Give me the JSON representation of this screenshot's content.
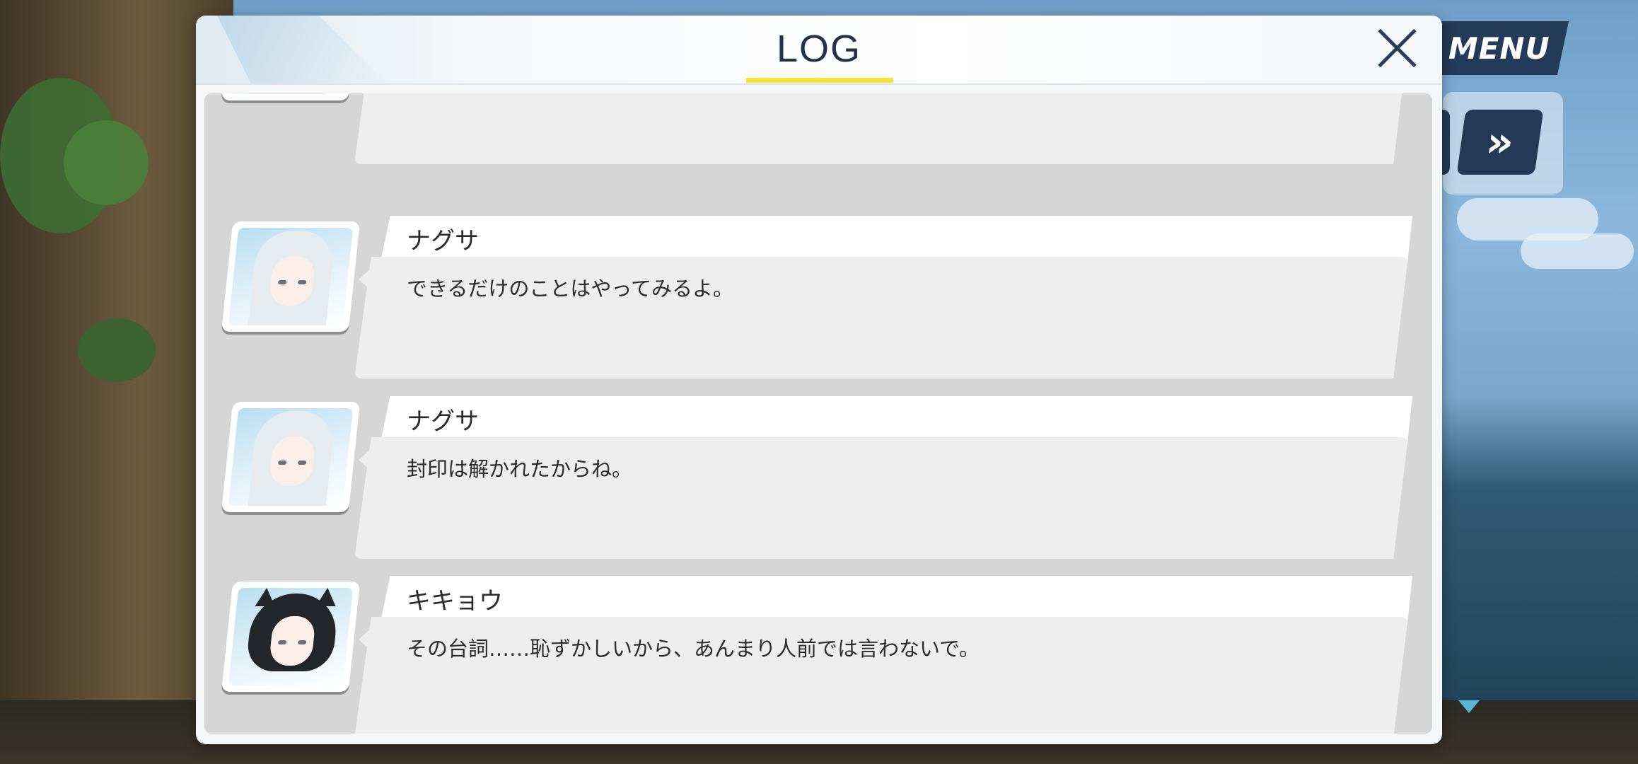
{
  "dialog": {
    "title": "LOG",
    "close_label": "Close"
  },
  "hud": {
    "menu_label": "MENU",
    "fast_forward_label": "»"
  },
  "log": {
    "partial_entry": {
      "text": ""
    },
    "entries": [
      {
        "speaker": "ナグサ",
        "line": "できるだけのことはやってみるよ。"
      },
      {
        "speaker": "ナグサ",
        "line": "封印は解かれたからね。"
      },
      {
        "speaker": "キキョウ",
        "line": "その台詞……恥ずかしいから、あんまり人前では言わないで。"
      }
    ]
  },
  "colors": {
    "accent_underline": "#f5e33c",
    "menu_bg": "#233a58",
    "title_text": "#24324d"
  }
}
